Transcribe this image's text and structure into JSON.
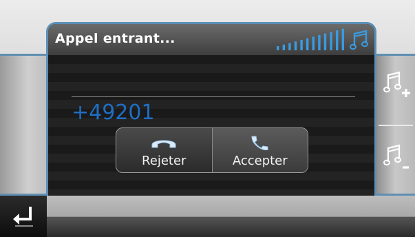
{
  "dialog": {
    "title": "Appel entrant...",
    "caller_number": "+49201",
    "signal_bars": 12,
    "music_icon": "music-note-icon"
  },
  "actions": {
    "reject_label": "Rejeter",
    "reject_icon": "phone-hangup-icon",
    "accept_label": "Accepter",
    "accept_icon": "phone-answer-icon"
  },
  "side_controls": {
    "volume_up_icon": "volume-up-icon",
    "volume_down_icon": "volume-down-icon"
  },
  "bottom": {
    "back_icon": "back-arrow-icon"
  },
  "colors": {
    "accent_blue": "#5b8fb7",
    "number_blue": "#1f6ec4",
    "signal_blue": "#3a9be0"
  }
}
